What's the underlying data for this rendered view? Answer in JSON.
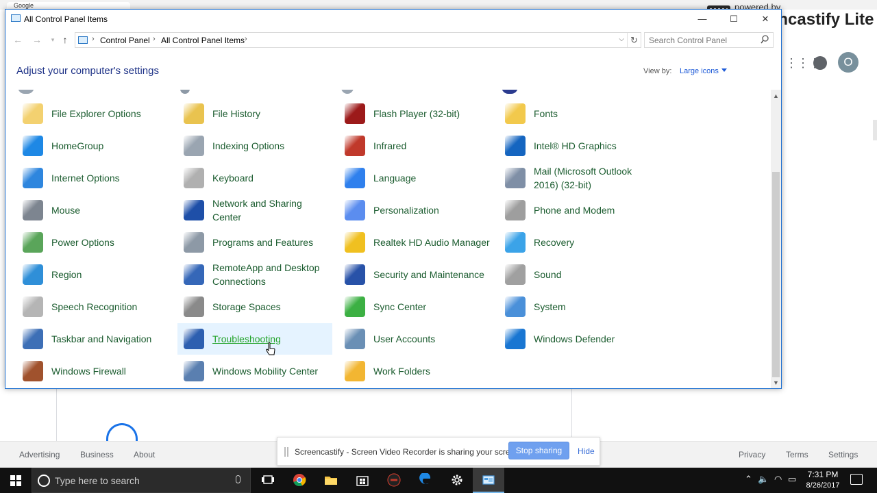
{
  "background_browser": {
    "tab_title": "Google",
    "footer_left": [
      "Advertising",
      "Business",
      "About"
    ],
    "footer_right": [
      "Privacy",
      "Terms",
      "Settings"
    ],
    "avatar_letter": "O",
    "apps_glyph": "⋮⋮⋮"
  },
  "watermark": {
    "powered_by": "powered by",
    "brand": "Screencastify Lite"
  },
  "window": {
    "title": "All Control Panel Items",
    "controls": {
      "minimize": "—",
      "maximize": "☐",
      "close": "✕"
    }
  },
  "address": {
    "breadcrumbs": [
      "Control Panel",
      "All Control Panel Items"
    ],
    "search_placeholder": "Search Control Panel"
  },
  "header": {
    "headline": "Adjust your computer's settings",
    "view_by_label": "View by:",
    "view_by_value": "Large icons"
  },
  "items": [
    {
      "label": "File Explorer Options",
      "icon": "folder-options-icon",
      "color": "#f3d170"
    },
    {
      "label": "File History",
      "icon": "file-history-icon",
      "color": "#e9c34f"
    },
    {
      "label": "Flash Player (32-bit)",
      "icon": "flash-player-icon",
      "color": "#9c1a1a"
    },
    {
      "label": "Fonts",
      "icon": "fonts-icon",
      "color": "#f2c94c"
    },
    {
      "label": "HomeGroup",
      "icon": "homegroup-icon",
      "color": "#1e88e5"
    },
    {
      "label": "Indexing Options",
      "icon": "indexing-options-icon",
      "color": "#9aa5b1"
    },
    {
      "label": "Infrared",
      "icon": "infrared-icon",
      "color": "#c0392b"
    },
    {
      "label": "Intel® HD Graphics",
      "icon": "intel-graphics-icon",
      "color": "#1565c0"
    },
    {
      "label": "Internet Options",
      "icon": "internet-options-icon",
      "color": "#2e86de"
    },
    {
      "label": "Keyboard",
      "icon": "keyboard-icon",
      "color": "#b0b0b0"
    },
    {
      "label": "Language",
      "icon": "language-icon",
      "color": "#2f80ed"
    },
    {
      "label": "Mail (Microsoft Outlook 2016) (32-bit)",
      "icon": "mail-icon",
      "color": "#7f8fa6"
    },
    {
      "label": "Mouse",
      "icon": "mouse-icon",
      "color": "#7d8590"
    },
    {
      "label": "Network and Sharing Center",
      "icon": "network-sharing-icon",
      "color": "#1e4fa8"
    },
    {
      "label": "Personalization",
      "icon": "personalization-icon",
      "color": "#5b8def"
    },
    {
      "label": "Phone and Modem",
      "icon": "phone-modem-icon",
      "color": "#9e9e9e"
    },
    {
      "label": "Power Options",
      "icon": "power-options-icon",
      "color": "#5aa55a"
    },
    {
      "label": "Programs and Features",
      "icon": "programs-features-icon",
      "color": "#8d99a6"
    },
    {
      "label": "Realtek HD Audio Manager",
      "icon": "realtek-audio-icon",
      "color": "#f0c020"
    },
    {
      "label": "Recovery",
      "icon": "recovery-icon",
      "color": "#3ba3e8"
    },
    {
      "label": "Region",
      "icon": "region-icon",
      "color": "#2f8fd8"
    },
    {
      "label": "RemoteApp and Desktop Connections",
      "icon": "remoteapp-icon",
      "color": "#3567b8"
    },
    {
      "label": "Security and Maintenance",
      "icon": "security-maintenance-icon",
      "color": "#2852a8"
    },
    {
      "label": "Sound",
      "icon": "sound-icon",
      "color": "#a0a0a0"
    },
    {
      "label": "Speech Recognition",
      "icon": "speech-recognition-icon",
      "color": "#b5b5b5"
    },
    {
      "label": "Storage Spaces",
      "icon": "storage-spaces-icon",
      "color": "#8a8a8a"
    },
    {
      "label": "Sync Center",
      "icon": "sync-center-icon",
      "color": "#3cb043"
    },
    {
      "label": "System",
      "icon": "system-icon",
      "color": "#4a90d9"
    },
    {
      "label": "Taskbar and Navigation",
      "icon": "taskbar-navigation-icon",
      "color": "#3d6fb6"
    },
    {
      "label": "Troubleshooting",
      "icon": "troubleshooting-icon",
      "color": "#2d5fb0",
      "hovered": true
    },
    {
      "label": "User Accounts",
      "icon": "user-accounts-icon",
      "color": "#6a8fb5"
    },
    {
      "label": "Windows Defender",
      "icon": "windows-defender-icon",
      "color": "#1976d2"
    },
    {
      "label": "Windows Firewall",
      "icon": "windows-firewall-icon",
      "color": "#a0522d"
    },
    {
      "label": "Windows Mobility Center",
      "icon": "mobility-center-icon",
      "color": "#5a7fb0"
    },
    {
      "label": "Work Folders",
      "icon": "work-folders-icon",
      "color": "#f2b632"
    }
  ],
  "share_bar": {
    "message": "Screencastify - Screen Video Recorder is sharing your screen.",
    "stop_label": "Stop sharing",
    "hide_label": "Hide"
  },
  "taskbar": {
    "search_placeholder": "Type here to search",
    "time": "7:31 PM",
    "date": "8/26/2017",
    "apps": [
      "task-view-icon",
      "chrome-icon",
      "file-explorer-icon",
      "store-icon",
      "game-app-icon",
      "edge-icon",
      "settings-icon",
      "control-panel-icon"
    ]
  }
}
